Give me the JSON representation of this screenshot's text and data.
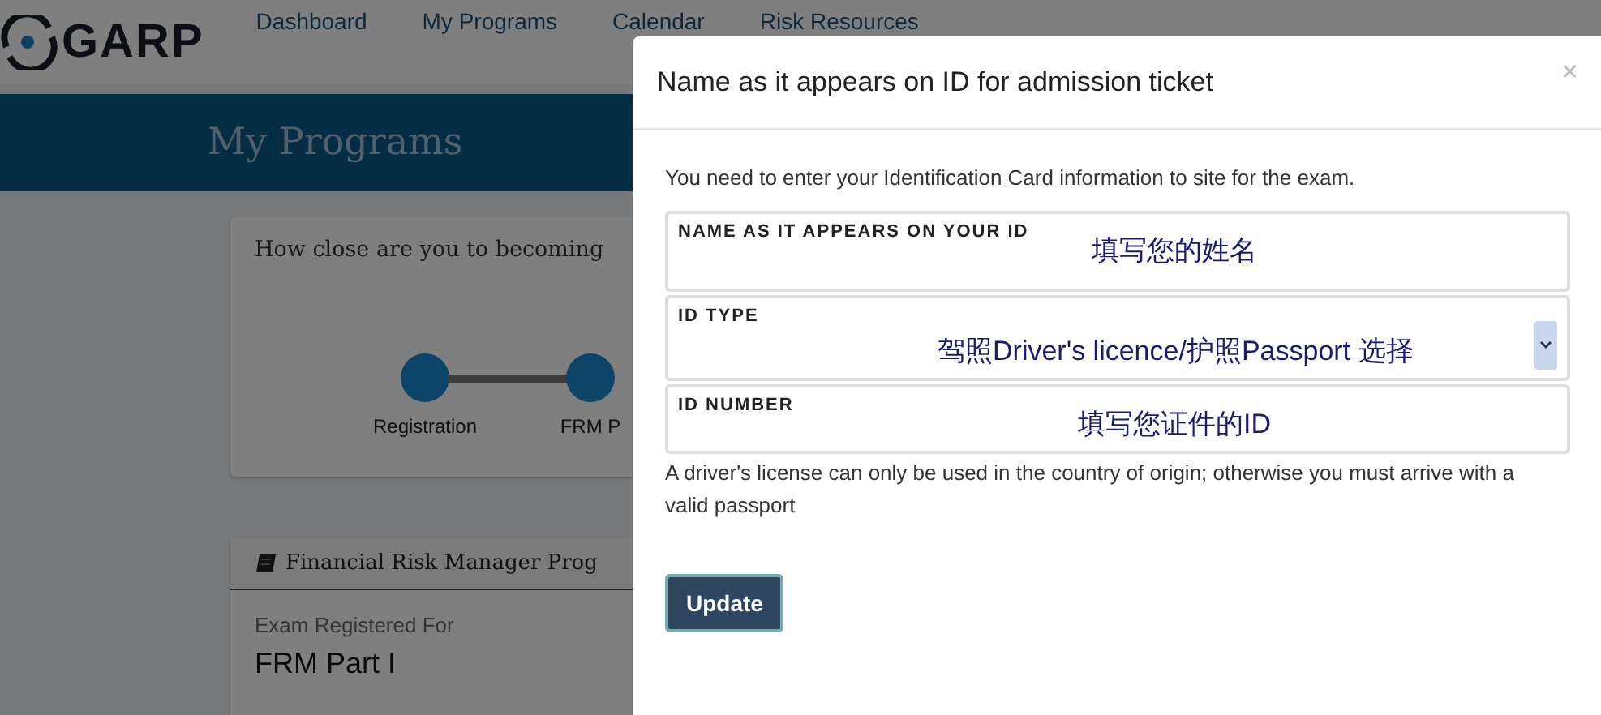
{
  "nav": {
    "logo": "GARP",
    "links": [
      {
        "label": "Dashboard",
        "selected": false
      },
      {
        "label": "My Programs",
        "selected": false
      },
      {
        "label": "Calendar",
        "selected": false
      },
      {
        "label": "Risk Resources",
        "selected": false
      }
    ]
  },
  "banner": {
    "title": "My Programs"
  },
  "progress_card": {
    "question": "How close are you to becoming",
    "steps": [
      {
        "label": "Registration",
        "done": true
      },
      {
        "label": "FRM P",
        "done": true
      }
    ]
  },
  "program_card": {
    "title": "Financial Risk Manager Prog",
    "label": "Exam Registered For",
    "value": "FRM Part I"
  },
  "modal": {
    "title": "Name as it appears on ID for admission ticket",
    "close": "×",
    "intro": "You need to enter your Identification Card information to site for the exam.",
    "fields": [
      {
        "kind": "text",
        "label": "NAME AS IT APPEARS ON YOUR ID",
        "value": "填写您的姓名"
      },
      {
        "kind": "select",
        "label": "ID TYPE",
        "value": "驾照Driver's licence/护照Passport 选择"
      },
      {
        "kind": "text",
        "label": "ID NUMBER",
        "value": "填写您证件的ID"
      }
    ],
    "note": "A driver's license can only be used in the country of origin; otherwise you must arrive with a valid passport",
    "button": "Update"
  }
}
